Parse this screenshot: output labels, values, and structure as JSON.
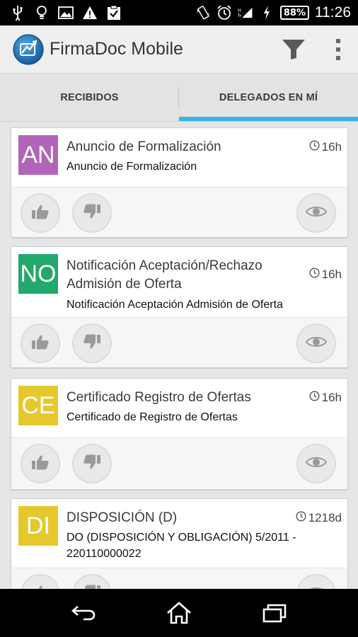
{
  "status_bar": {
    "battery": "88",
    "time": "11:26",
    "icons": [
      "usb-icon",
      "lightbulb-icon",
      "image-icon",
      "warning-icon",
      "clipboard-check-icon",
      "vibrate-icon",
      "alarm-icon",
      "signal-icon",
      "charging-icon",
      "battery-icon"
    ]
  },
  "action_bar": {
    "title": "FirmaDoc Mobile",
    "icons": [
      "app-logo-icon",
      "filter-icon",
      "overflow-menu-icon"
    ]
  },
  "tabs": [
    {
      "label": "RECIBIDOS",
      "active": false
    },
    {
      "label": "DELEGADOS EN MÍ",
      "active": true
    }
  ],
  "colors": {
    "accent": "#33b5e5",
    "badge_an": "#b065b8",
    "badge_no": "#21a86b",
    "badge_ce": "#e5c92c",
    "badge_di": "#e5c92c"
  },
  "cards": [
    {
      "badge": "AN",
      "title": "Anuncio de Formalización",
      "subtitle": "Anuncio de Formalización",
      "time": "16h"
    },
    {
      "badge": "NO",
      "title_line1": "Notificación Aceptación/Rechazo",
      "title_line2": "Admisión de Oferta",
      "subtitle": "Notificación Aceptación Admisión de Oferta",
      "time": "16h"
    },
    {
      "badge": "CE",
      "title": "Certificado Registro de Ofertas",
      "subtitle": "Certificado de Registro de Ofertas",
      "time": "16h"
    },
    {
      "badge": "DI",
      "title": "DISPOSICIÓN (D)",
      "subtitle_line1": "DO (DISPOSICIÓN Y OBLIGACIÓN) 5/2011 -",
      "subtitle_line2": "220110000022",
      "time": "1218d"
    }
  ],
  "card_action_icons": [
    "thumbs-up-icon",
    "thumbs-down-icon",
    "eye-icon"
  ],
  "nav_bar": {
    "icons": [
      "back-icon",
      "home-icon",
      "recent-apps-icon"
    ]
  }
}
